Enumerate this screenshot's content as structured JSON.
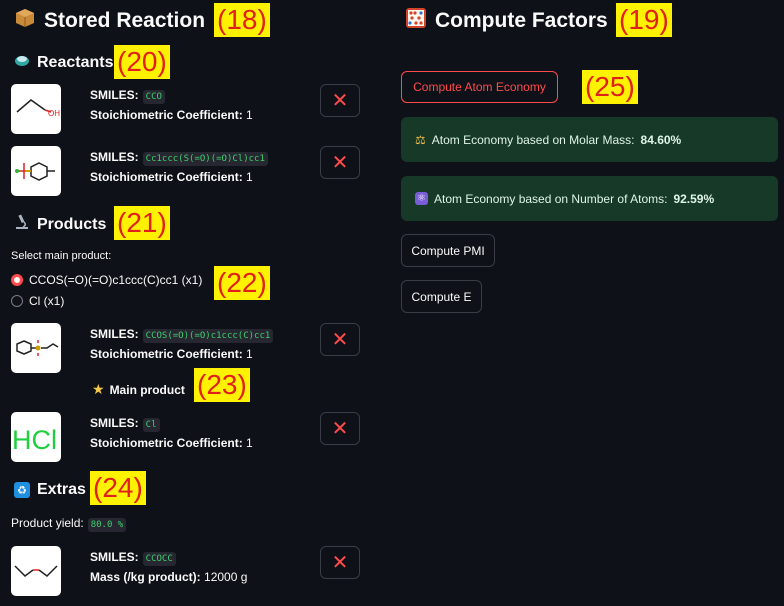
{
  "left": {
    "title": "Stored Reaction",
    "title_icon": "package-icon",
    "reactants": {
      "heading": "Reactants",
      "items": [
        {
          "smiles_label": "SMILES:",
          "smiles": "CCO",
          "coef_label": "Stoichiometric Coefficient:",
          "coef": "1",
          "thumb_text": "OH"
        },
        {
          "smiles_label": "SMILES:",
          "smiles": "Cc1ccc(S(=O)(=O)Cl)cc1",
          "coef_label": "Stoichiometric Coefficient:",
          "coef": "1"
        }
      ]
    },
    "products": {
      "heading": "Products",
      "select_label": "Select main product:",
      "options": [
        "CCOS(=O)(=O)c1ccc(C)cc1 (x1)",
        "Cl (x1)"
      ],
      "selected_index": 0,
      "items": [
        {
          "smiles_label": "SMILES:",
          "smiles": "CCOS(=O)(=O)c1ccc(C)cc1",
          "coef_label": "Stoichiometric Coefficient:",
          "coef": "1",
          "badge": "Main product"
        },
        {
          "smiles_label": "SMILES:",
          "smiles": "Cl",
          "coef_label": "Stoichiometric Coefficient:",
          "coef": "1",
          "thumb_text": "HCl"
        }
      ]
    },
    "extras": {
      "heading": "Extras",
      "yield_label": "Product yield:",
      "yield_value": "80.0 %",
      "items": [
        {
          "smiles_label": "SMILES:",
          "smiles": "CCOCC",
          "mass_label": "Mass (/kg product):",
          "mass": "12000 g"
        }
      ]
    },
    "remove_glyph": "✕"
  },
  "right": {
    "title": "Compute Factors",
    "title_icon": "abacus-icon",
    "btn_atom_economy": "Compute Atom Economy",
    "result_molar": {
      "label": "Atom Economy based on Molar Mass:",
      "value": "84.60%",
      "icon": "balance-scale-icon"
    },
    "result_atoms": {
      "label": "Atom Economy based on Number of Atoms:",
      "value": "92.59%",
      "icon": "atom-icon"
    },
    "btn_pmi": "Compute PMI",
    "btn_e": "Compute E"
  },
  "annotations": [
    "(18)",
    "(19)",
    "(20)",
    "(21)",
    "(22)",
    "(23)",
    "(24)",
    "(25)"
  ],
  "colors": {
    "background": "#0e1117",
    "accent": "#ff4b4b",
    "code_green": "#3ecf6e",
    "success_bg": "#173928",
    "annotation_bg": "#fff200",
    "annotation_text": "#e0201a"
  }
}
